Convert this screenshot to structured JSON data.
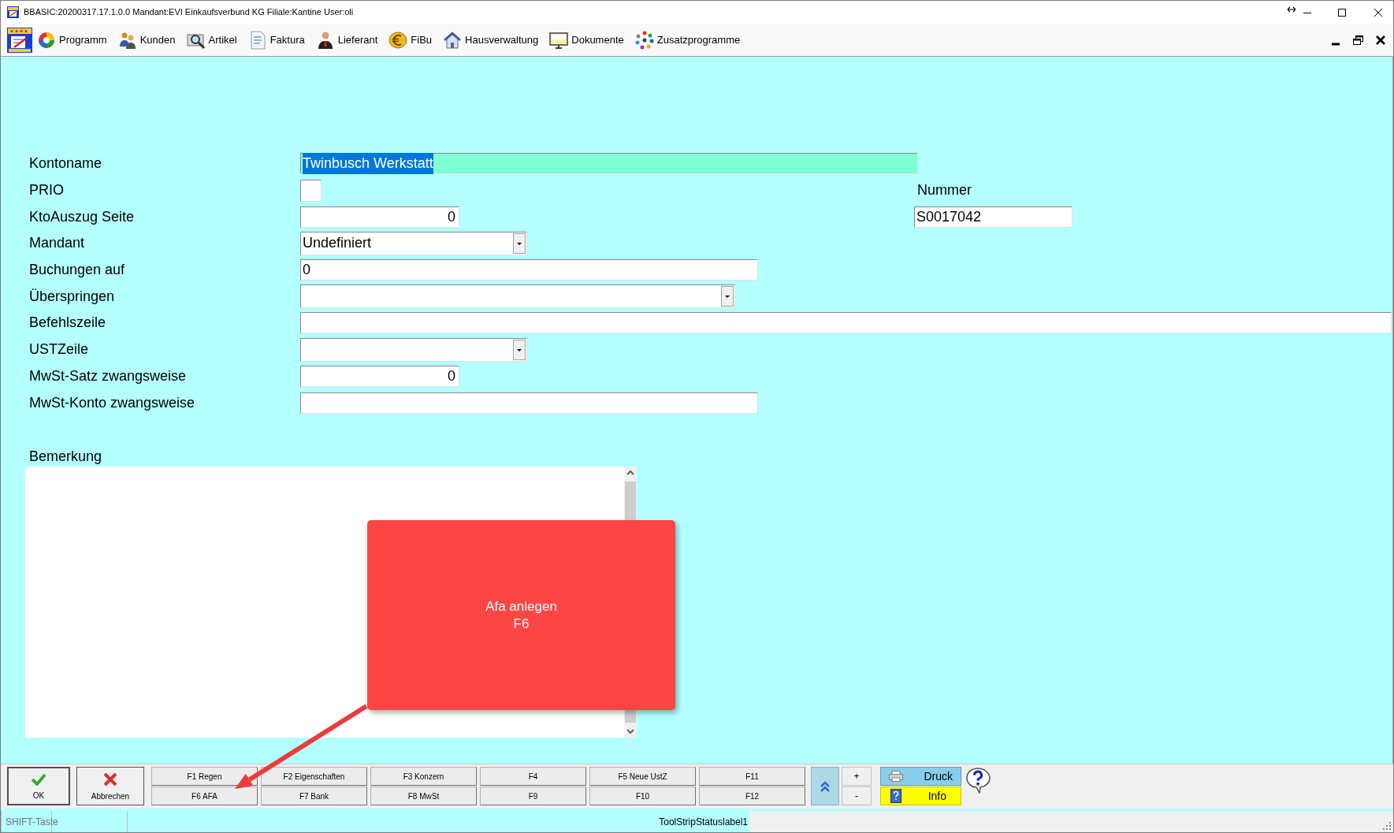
{
  "window": {
    "title": "BBASIC:20200317.17.1.0.0 Mandant:EVI Einkaufsverbund KG Filiale:Kantine User:oli"
  },
  "menu": {
    "items": [
      {
        "label": "Programm"
      },
      {
        "label": "Kunden"
      },
      {
        "label": "Artikel"
      },
      {
        "label": "Faktura"
      },
      {
        "label": "Lieferant"
      },
      {
        "label": "FiBu"
      },
      {
        "label": "Hausverwaltung"
      },
      {
        "label": "Dokumente"
      },
      {
        "label": "Zusatzprogramme"
      }
    ]
  },
  "form": {
    "fields": [
      {
        "label": "Kontoname",
        "kind": "text",
        "value": "Twinbusch Werkstatt",
        "focused": true
      },
      {
        "label": "PRIO",
        "kind": "checkbox",
        "checked": false,
        "focused": false
      },
      {
        "label": "KtoAuszug Seite",
        "kind": "number",
        "value": "0",
        "focused": false
      },
      {
        "label": "Mandant",
        "kind": "select",
        "value": "Undefiniert",
        "focused": false
      },
      {
        "label": "Buchungen auf",
        "kind": "text",
        "value": "0",
        "focused": false
      },
      {
        "label": "Überspringen",
        "kind": "select",
        "focused": false
      },
      {
        "label": "Befehlszeile",
        "kind": "text",
        "focused": false
      },
      {
        "label": "USTZeile",
        "kind": "select",
        "focused": false
      },
      {
        "label": "MwSt-Satz zwangsweise",
        "kind": "number",
        "value": "0",
        "focused": false
      },
      {
        "label": "MwSt-Konto zwangsweise",
        "kind": "text",
        "focused": false
      }
    ],
    "nummer": {
      "label": "Nummer",
      "value": "S0017042"
    },
    "remark": {
      "label": "Bemerkung"
    }
  },
  "callout": {
    "text": "Afa anlegen\nF6"
  },
  "toolbar": {
    "buttons": [
      {
        "kind": "ok",
        "label": "OK"
      },
      {
        "kind": "cancel",
        "label": "Abbrechen"
      }
    ],
    "function_keys": [
      {
        "top": "F1 Regen",
        "bottom": "F6 AFA"
      },
      {
        "top": "F2 Eigenschaften",
        "bottom": "F7 Bank"
      },
      {
        "top": "F3 Konzern",
        "bottom": "F8 MwSt"
      },
      {
        "top": "F4",
        "bottom": "F9"
      },
      {
        "top": "F5 Neue UstZ",
        "bottom": "F10"
      },
      {
        "top": "F11",
        "bottom": "F12"
      }
    ],
    "zoom_buttons": [
      "+",
      "-"
    ],
    "print": "Druck",
    "info": "Info"
  },
  "status_bar": {
    "shift": "SHIFT-Taste",
    "label": "ToolStripStatuslabel1"
  }
}
